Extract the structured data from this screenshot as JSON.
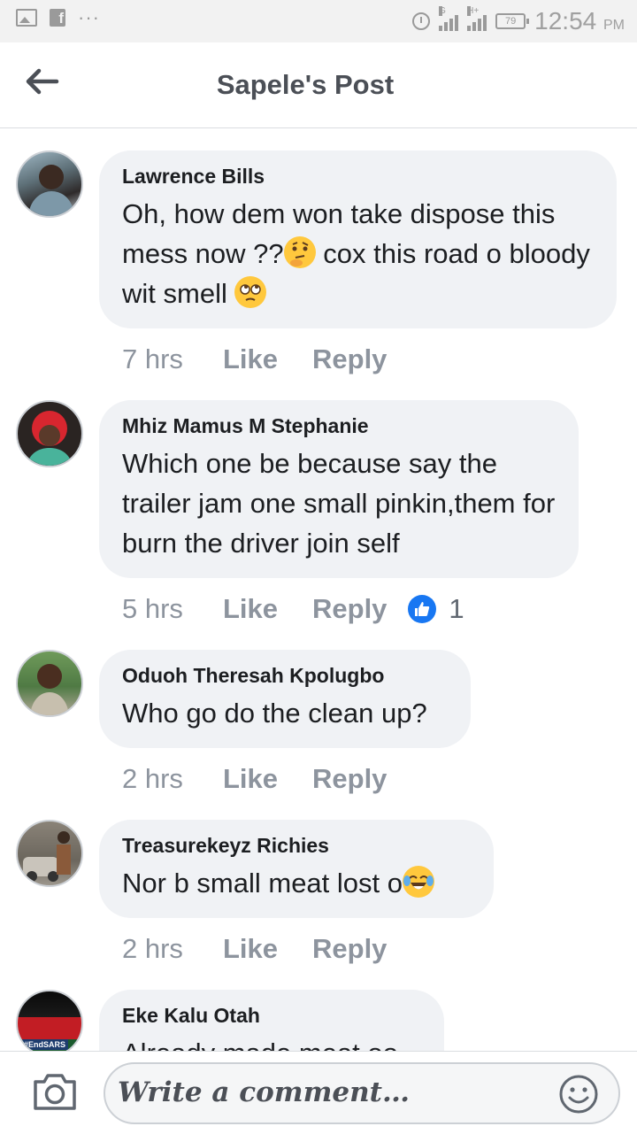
{
  "status_bar": {
    "time": "12:54",
    "ampm": "PM",
    "battery": "79",
    "network_1": "G",
    "network_2": "H+",
    "icons": [
      "gallery-icon",
      "facebook-icon",
      "more-icon",
      "alarm-icon",
      "signal-icon",
      "battery-icon"
    ]
  },
  "header": {
    "title": "Sapele's Post",
    "back_icon": "arrow-left-icon"
  },
  "comments": [
    {
      "author": "Lawrence Bills",
      "text": "Oh, how dem won take dispose this mess now ??",
      "text_after_emoji": " cox this road o bloody wit smell ",
      "emojis": [
        "thinking-face",
        "rolling-eyes-face"
      ],
      "time": "7 hrs",
      "like": "Like",
      "reply": "Reply"
    },
    {
      "author": "Mhiz Mamus M Stephanie",
      "text": "Which one be because say the trailer jam one small pinkin,them for burn the driver join self",
      "time": "5 hrs",
      "like": "Like",
      "reply": "Reply",
      "reaction_count": "1",
      "reaction_icon": "thumbs-up-icon"
    },
    {
      "author": "Oduoh Theresah Kpolugbo",
      "text": "Who go do the clean up?",
      "time": "2 hrs",
      "like": "Like",
      "reply": "Reply"
    },
    {
      "author": "Treasurekeyz Richies",
      "text": "Nor b small meat lost o",
      "emojis": [
        "tears-of-joy-face"
      ],
      "time": "2 hrs",
      "like": "Like",
      "reply": "Reply"
    },
    {
      "author": "Eke Kalu Otah",
      "text": "Already made meat oo",
      "avatar_caption": "#EndSARS"
    }
  ],
  "composer": {
    "placeholder": "Write a comment…",
    "camera_icon": "camera-icon",
    "emoji_icon": "smiley-icon"
  },
  "colors": {
    "bubble": "#f0f2f5",
    "meta_text": "#8d949e",
    "like_blue": "#1877f2"
  }
}
